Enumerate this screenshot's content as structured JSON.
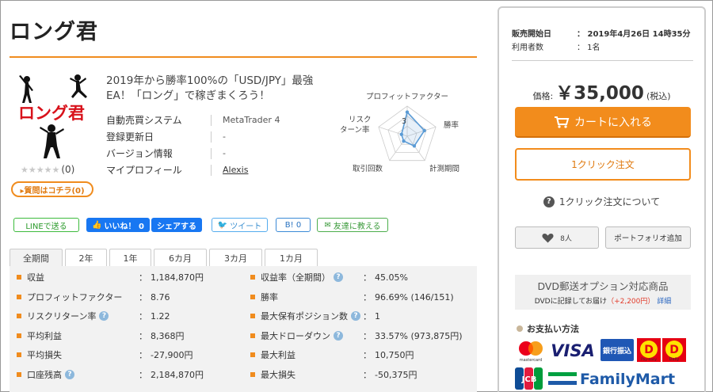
{
  "product": {
    "title": "ロング君",
    "logo_text": "ロング君",
    "catch_copy": "2019年から勝率100%の「USD/JPY」最強EA！「ロング」で稼ぎまくろう！",
    "rating_stars": "★★★★★",
    "review_count": "(0)",
    "question_button": "▸質問はコチラ(0)"
  },
  "info": [
    {
      "label": "自動売買システム",
      "value": "MetaTrader 4"
    },
    {
      "label": "登録更新日",
      "value": "-"
    },
    {
      "label": "バージョン情報",
      "value": "-"
    },
    {
      "label": "マイプロフィール",
      "value": "Alexis"
    }
  ],
  "radar": {
    "labels": [
      "プロフィットファクター",
      "勝率",
      "計測期間",
      "取引回数",
      "リスク\nターン率"
    ],
    "label_top": "プロフィットファクター",
    "label_right": "勝率",
    "label_bottom_right": "計測期間",
    "label_bottom_left": "取引回数",
    "label_left_1": "リスク",
    "label_left_2": "ターン率",
    "center_value": "3",
    "values": [
      4,
      3,
      2,
      1,
      1
    ],
    "max": 5,
    "accent": "#5b9bd5"
  },
  "social": {
    "line": "LINEで送る",
    "like": "いいね！ 0",
    "share": "シェアする",
    "tweet": "ツイート",
    "hatena": "B! 0",
    "friend": "友達に教える"
  },
  "tabs": [
    "全期間",
    "2年",
    "1年",
    "6カ月",
    "3カ月",
    "1カ月"
  ],
  "stats_left": [
    {
      "label": "収益",
      "value": "1,184,870円",
      "help": false
    },
    {
      "label": "プロフィットファクター",
      "value": "8.76",
      "help": false
    },
    {
      "label": "リスクリターン率",
      "value": "1.22",
      "help": true
    },
    {
      "label": "平均利益",
      "value": "8,368円",
      "help": false
    },
    {
      "label": "平均損失",
      "value": "-27,900円",
      "help": false
    },
    {
      "label": "口座残高",
      "value": "2,184,870円",
      "help": true
    }
  ],
  "stats_right": [
    {
      "label": "収益率（全期間）",
      "value": "45.05%",
      "help": true
    },
    {
      "label": "勝率",
      "value": "96.69% (146/151)",
      "help": false
    },
    {
      "label": "最大保有ポジション数",
      "value": "1",
      "help": true
    },
    {
      "label": "最大ドローダウン",
      "value": "33.57% (973,875円)",
      "help": true
    },
    {
      "label": "最大利益",
      "value": "10,750円",
      "help": false
    },
    {
      "label": "最大損失",
      "value": "-50,375円",
      "help": false
    }
  ],
  "sidebar": {
    "sale_start_label": "販売開始日",
    "sale_start_value": "：  2019年4月26日 14時35分",
    "users_label": "利用者数",
    "users_value": "：  1名",
    "price_label": "価格:",
    "price": "￥35,000",
    "tax": "(税込)",
    "cart_button": "カートに入れる",
    "oneclick_button": "1クリック注文",
    "oneclick_about": "1クリック注文について",
    "favorite": "8人",
    "portfolio_button": "ポートフォリオ追加",
    "dvd_title": "DVD郵送オプション対応商品",
    "dvd_desc": "DVDに記録してお届け",
    "dvd_price": "（+2,200円）",
    "dvd_link": "詳細",
    "payment_title": "お支払い方法",
    "payment_methods": [
      "mastercard",
      "VISA",
      "銀行振込",
      "Pay-easy",
      "Daily",
      "JCB",
      "FamilyMart"
    ]
  },
  "colors": {
    "accent": "#f08c1e",
    "facebook": "#1877f2",
    "visa": "#1a1f71",
    "familymart": "#1e5aa8"
  }
}
